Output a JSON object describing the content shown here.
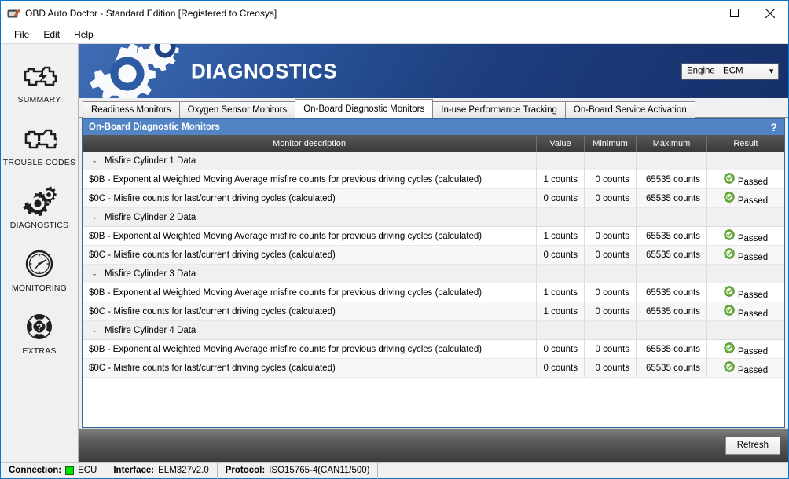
{
  "window": {
    "title": "OBD Auto Doctor - Standard Edition [Registered to Creosys]",
    "app_icon": "obd-app-icon",
    "minimize_label": "–",
    "maximize_label": "□",
    "close_label": "✕"
  },
  "menubar": {
    "items": [
      {
        "label": "File"
      },
      {
        "label": "Edit"
      },
      {
        "label": "Help"
      }
    ]
  },
  "sidebar": {
    "items": [
      {
        "label": "SUMMARY",
        "icon": "engine-icon"
      },
      {
        "label": "TROUBLE CODES",
        "icon": "check-engine-warning-icon"
      },
      {
        "label": "DIAGNOSTICS",
        "icon": "gears-icon"
      },
      {
        "label": "MONITORING",
        "icon": "gauge-icon"
      },
      {
        "label": "EXTRAS",
        "icon": "life-ring-question-icon"
      }
    ]
  },
  "banner": {
    "title": "DIAGNOSTICS",
    "icon": "gears-icon",
    "ecu_selector": {
      "value": "Engine - ECM",
      "caret": "▼"
    },
    "gradient_from": "#3f6db5",
    "gradient_to": "#16306a"
  },
  "tabs": [
    {
      "label": "Readiness Monitors",
      "active": false
    },
    {
      "label": "Oxygen Sensor Monitors",
      "active": false
    },
    {
      "label": "On-Board Diagnostic Monitors",
      "active": true
    },
    {
      "label": "In-use Performance Tracking",
      "active": false
    },
    {
      "label": "On-Board Service Activation",
      "active": false
    }
  ],
  "panel": {
    "title": "On-Board Diagnostic Monitors",
    "help_label": "?",
    "accent_color": "#5283c4"
  },
  "table": {
    "columns": [
      {
        "key": "description",
        "label": "Monitor description"
      },
      {
        "key": "value",
        "label": "Value"
      },
      {
        "key": "minimum",
        "label": "Minimum"
      },
      {
        "key": "maximum",
        "label": "Maximum"
      },
      {
        "key": "result",
        "label": "Result"
      }
    ],
    "chevron_expanded": "⌄",
    "result_ok_color": "#6db33f",
    "groups": [
      {
        "label": "Misfire Cylinder 1 Data",
        "expanded": true,
        "rows": [
          {
            "description": "$0B - Exponential Weighted Moving Average misfire counts for previous driving cycles (calculated)",
            "value": "1 counts",
            "minimum": "0 counts",
            "maximum": "65535 counts",
            "result": "Passed"
          },
          {
            "description": "$0C - Misfire counts for last/current driving cycles (calculated)",
            "value": "0 counts",
            "minimum": "0 counts",
            "maximum": "65535 counts",
            "result": "Passed"
          }
        ]
      },
      {
        "label": "Misfire Cylinder 2 Data",
        "expanded": true,
        "rows": [
          {
            "description": "$0B - Exponential Weighted Moving Average misfire counts for previous driving cycles (calculated)",
            "value": "1 counts",
            "minimum": "0 counts",
            "maximum": "65535 counts",
            "result": "Passed"
          },
          {
            "description": "$0C - Misfire counts for last/current driving cycles (calculated)",
            "value": "0 counts",
            "minimum": "0 counts",
            "maximum": "65535 counts",
            "result": "Passed"
          }
        ]
      },
      {
        "label": "Misfire Cylinder 3 Data",
        "expanded": true,
        "rows": [
          {
            "description": "$0B - Exponential Weighted Moving Average misfire counts for previous driving cycles (calculated)",
            "value": "1 counts",
            "minimum": "0 counts",
            "maximum": "65535 counts",
            "result": "Passed"
          },
          {
            "description": "$0C - Misfire counts for last/current driving cycles (calculated)",
            "value": "1 counts",
            "minimum": "0 counts",
            "maximum": "65535 counts",
            "result": "Passed"
          }
        ]
      },
      {
        "label": "Misfire Cylinder 4 Data",
        "expanded": true,
        "rows": [
          {
            "description": "$0B - Exponential Weighted Moving Average misfire counts for previous driving cycles (calculated)",
            "value": "0 counts",
            "minimum": "0 counts",
            "maximum": "65535 counts",
            "result": "Passed"
          },
          {
            "description": "$0C - Misfire counts for last/current driving cycles (calculated)",
            "value": "0 counts",
            "minimum": "0 counts",
            "maximum": "65535 counts",
            "result": "Passed"
          }
        ]
      }
    ]
  },
  "footer": {
    "refresh_label": "Refresh"
  },
  "statusbar": {
    "connection_label": "Connection:",
    "connection_value": "ECU",
    "connection_led_color": "#00e000",
    "interface_label": "Interface:",
    "interface_value": "ELM327v2.0",
    "protocol_label": "Protocol:",
    "protocol_value": "ISO15765-4(CAN11/500)"
  }
}
